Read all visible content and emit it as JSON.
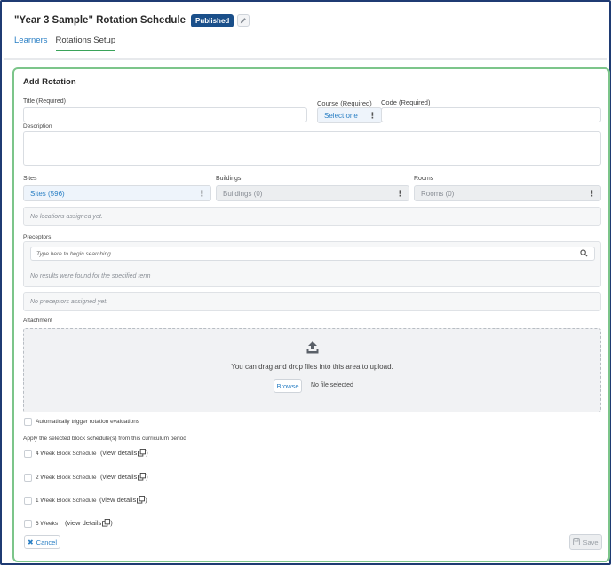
{
  "header": {
    "title": "\"Year 3 Sample\" Rotation Schedule",
    "status_badge": "Published",
    "edit_icon": "pencil-icon"
  },
  "tabs": [
    {
      "label": "Learners",
      "active": false
    },
    {
      "label": "Rotations Setup",
      "active": true
    }
  ],
  "form": {
    "heading": "Add Rotation",
    "title_label": "Title (Required)",
    "title_value": "",
    "course_label": "Course (Required)",
    "course_value": "Select one",
    "code_label": "Code (Required)",
    "code_value": "",
    "description_label": "Description",
    "description_value": "",
    "sites_label": "Sites",
    "sites_value": "Sites (596)",
    "buildings_label": "Buildings",
    "buildings_value": "Buildings (0)",
    "rooms_label": "Rooms",
    "rooms_value": "Rooms (0)",
    "no_locations": "No locations assigned yet.",
    "preceptors_label": "Preceptors",
    "preceptor_search_placeholder": "Type here to begin searching",
    "no_results": "No results were found for the specified term",
    "no_preceptors": "No preceptors assigned yet.",
    "attachment_label": "Attachment",
    "upload_message": "You can drag and drop files into this area to upload.",
    "browse_label": "Browse",
    "no_file": "No file selected",
    "auto_trigger_label": "Automatically trigger rotation evaluations",
    "apply_schedule_label": "Apply the selected block schedule(s) from this curriculum period",
    "block_schedules": [
      {
        "label": "4 Week Block Schedule",
        "view": "(view details"
      },
      {
        "label": "2 Week Block Schedule",
        "view": "(view details"
      },
      {
        "label": "1 Week Block Schedule",
        "view": "(view details"
      },
      {
        "label": "6 Weeks",
        "view": "(view details"
      }
    ],
    "cancel_label": "Cancel",
    "save_label": "Save"
  },
  "colors": {
    "accent_blue": "#2a7fc4",
    "badge_blue": "#1a4f8a",
    "panel_border": "#7cc58a",
    "frame_border": "#1f3b73"
  }
}
